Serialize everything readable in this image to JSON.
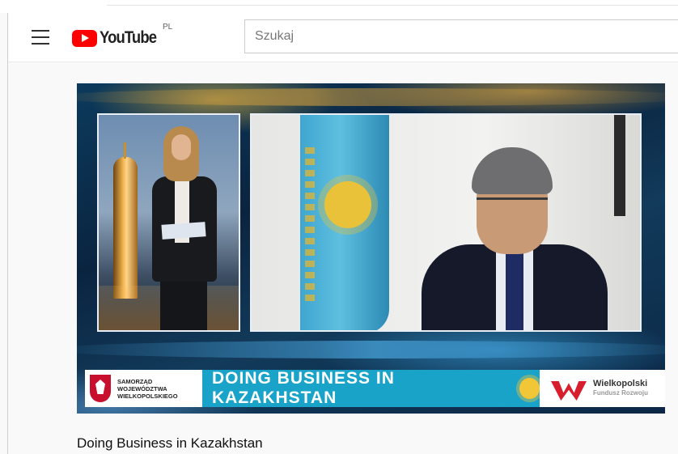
{
  "masthead": {
    "logo_text": "YouTube",
    "region": "PL",
    "search_placeholder": "Szukaj"
  },
  "video": {
    "lower_third": {
      "org_left": "SAMORZĄD WOJEWÓDZTWA WIELKOPOLSKIEGO",
      "banner_title": "DOING BUSINESS IN KAZAKHSTAN",
      "org_right_line1": "Wielkopolski",
      "org_right_line2": "Fundusz Rozwoju"
    },
    "title": "Doing Business in Kazakhstan"
  },
  "colors": {
    "brand_red": "#ff0000",
    "banner_blue": "#1aa3c9"
  }
}
